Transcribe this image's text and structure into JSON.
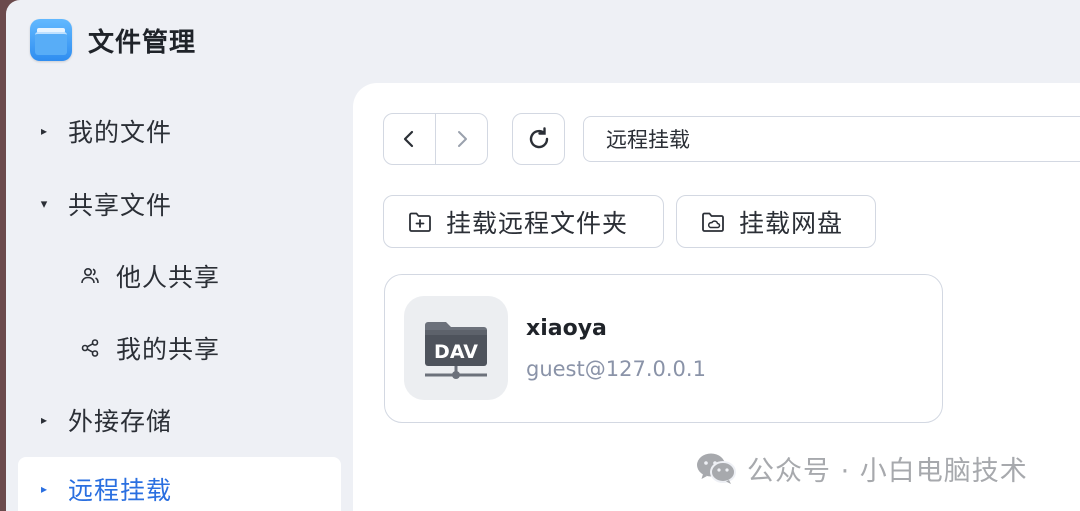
{
  "app": {
    "title": "文件管理"
  },
  "sidebar": {
    "items": [
      {
        "label": "我的文件",
        "expanded": false,
        "active": false
      },
      {
        "label": "共享文件",
        "expanded": true,
        "active": false
      },
      {
        "label": "他人共享",
        "sub": true,
        "icon": "users-icon"
      },
      {
        "label": "我的共享",
        "sub": true,
        "icon": "share-icon"
      },
      {
        "label": "外接存储",
        "expanded": false,
        "active": false
      },
      {
        "label": "远程挂载",
        "expanded": false,
        "active": true
      }
    ]
  },
  "toolbar": {
    "path": "远程挂载",
    "back_icon": "chevron-left-icon",
    "forward_icon": "chevron-right-icon",
    "refresh_icon": "refresh-icon"
  },
  "actions": {
    "mount_folder_label": "挂载远程文件夹",
    "mount_drive_label": "挂载网盘"
  },
  "mounts": [
    {
      "name": "xiaoya",
      "address": "guest@127.0.0.1",
      "icon_label": "DAV"
    }
  ],
  "watermark": {
    "text": "公众号 · 小白电脑技术"
  },
  "colors": {
    "accent": "#2a6fe0",
    "sidebar_bg": "#eef0f5",
    "border": "#d3d8e2"
  }
}
